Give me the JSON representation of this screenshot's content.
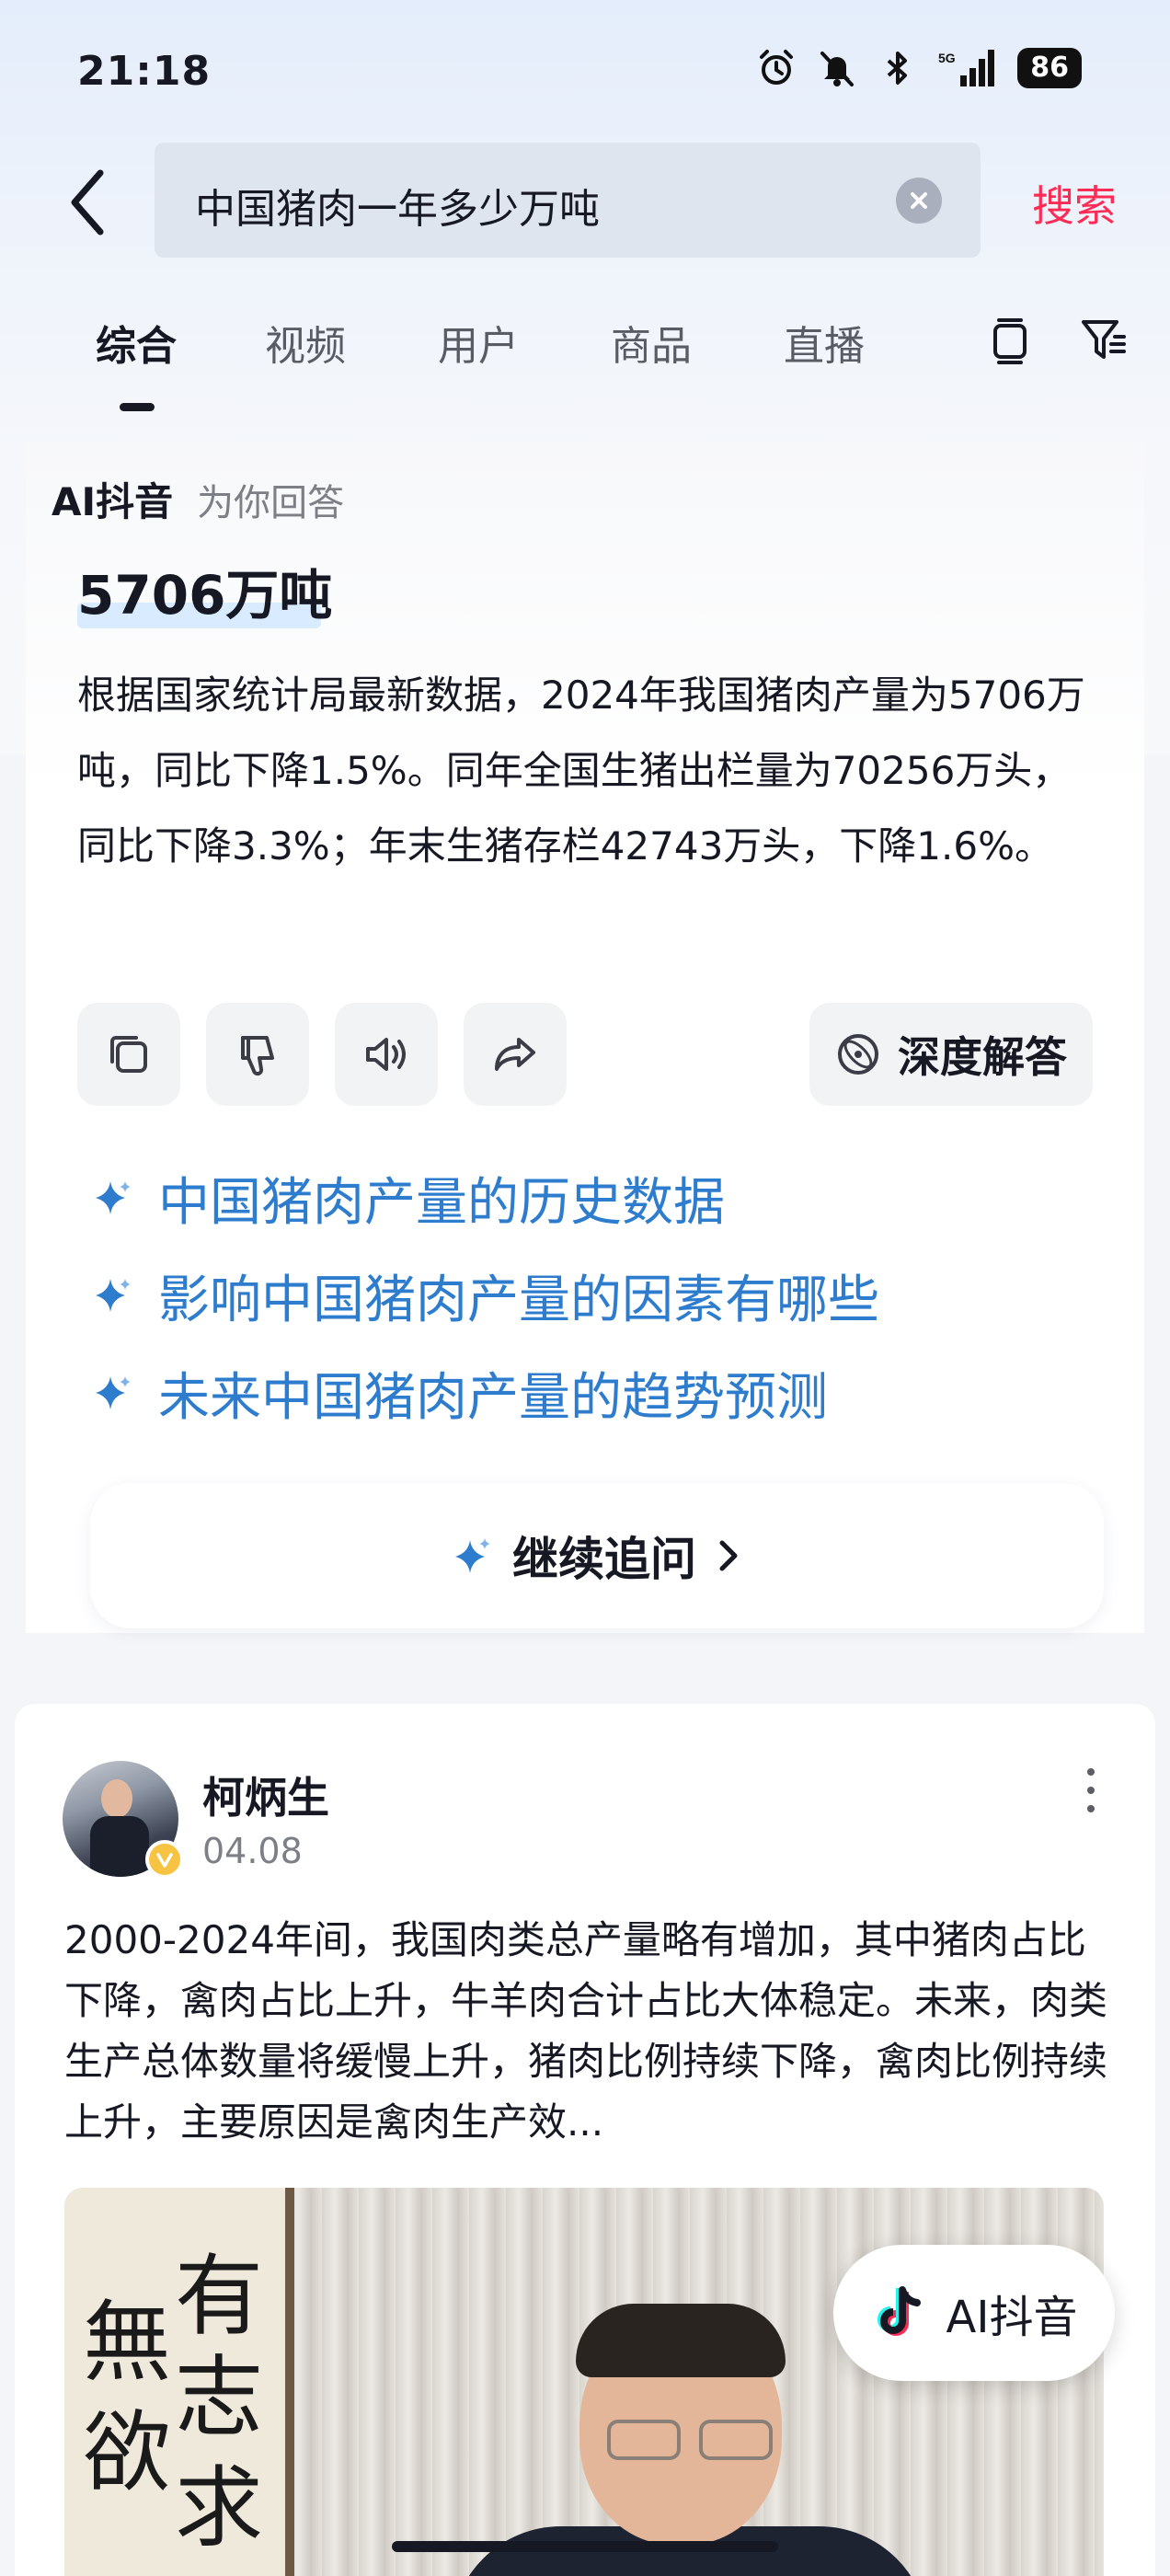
{
  "status_bar": {
    "time": "21:18",
    "network": "5G",
    "battery": "86",
    "icons": [
      "alarm-icon",
      "mute-icon",
      "bluetooth-icon",
      "signal-icon",
      "battery-icon"
    ]
  },
  "search": {
    "query": "中国猪肉一年多少万吨",
    "submit_label": "搜索"
  },
  "tabs": [
    {
      "label": "综合",
      "active": true
    },
    {
      "label": "视频",
      "active": false
    },
    {
      "label": "用户",
      "active": false
    },
    {
      "label": "商品",
      "active": false
    },
    {
      "label": "直播",
      "active": false
    }
  ],
  "ai_answer": {
    "brand": "AI抖音",
    "subtitle": "为你回答",
    "headline": "5706万吨",
    "body": "根据国家统计局最新数据，2024年我国猪肉产量为5706万吨，同比下降1.5%。同年全国生猪出栏量为70256万头，同比下降3.3%；年末生猪存栏42743万头，下降1.6%。",
    "deep_answer_label": "深度解答",
    "related_questions": [
      "中国猪肉产量的历史数据",
      "影响中国猪肉产量的因素有哪些",
      "未来中国猪肉产量的趋势预测"
    ],
    "follow_up_label": "继续追问"
  },
  "post": {
    "author": "柯炳生",
    "date": "04.08",
    "text": "2000-2024年间，我国肉类总产量略有增加，其中猪肉占比下降，禽肉占比上升，牛羊肉合计占比大体稳定。未来，肉类生产总体数量将缓慢上升，猪肉比例持续下降，禽肉比例持续上升，主要原因是禽肉生产效..."
  },
  "float_button": {
    "label": "AI抖音"
  },
  "colors": {
    "accent_red": "#fe2c55",
    "link_blue": "#2d7ccd",
    "text_primary": "#161823"
  }
}
